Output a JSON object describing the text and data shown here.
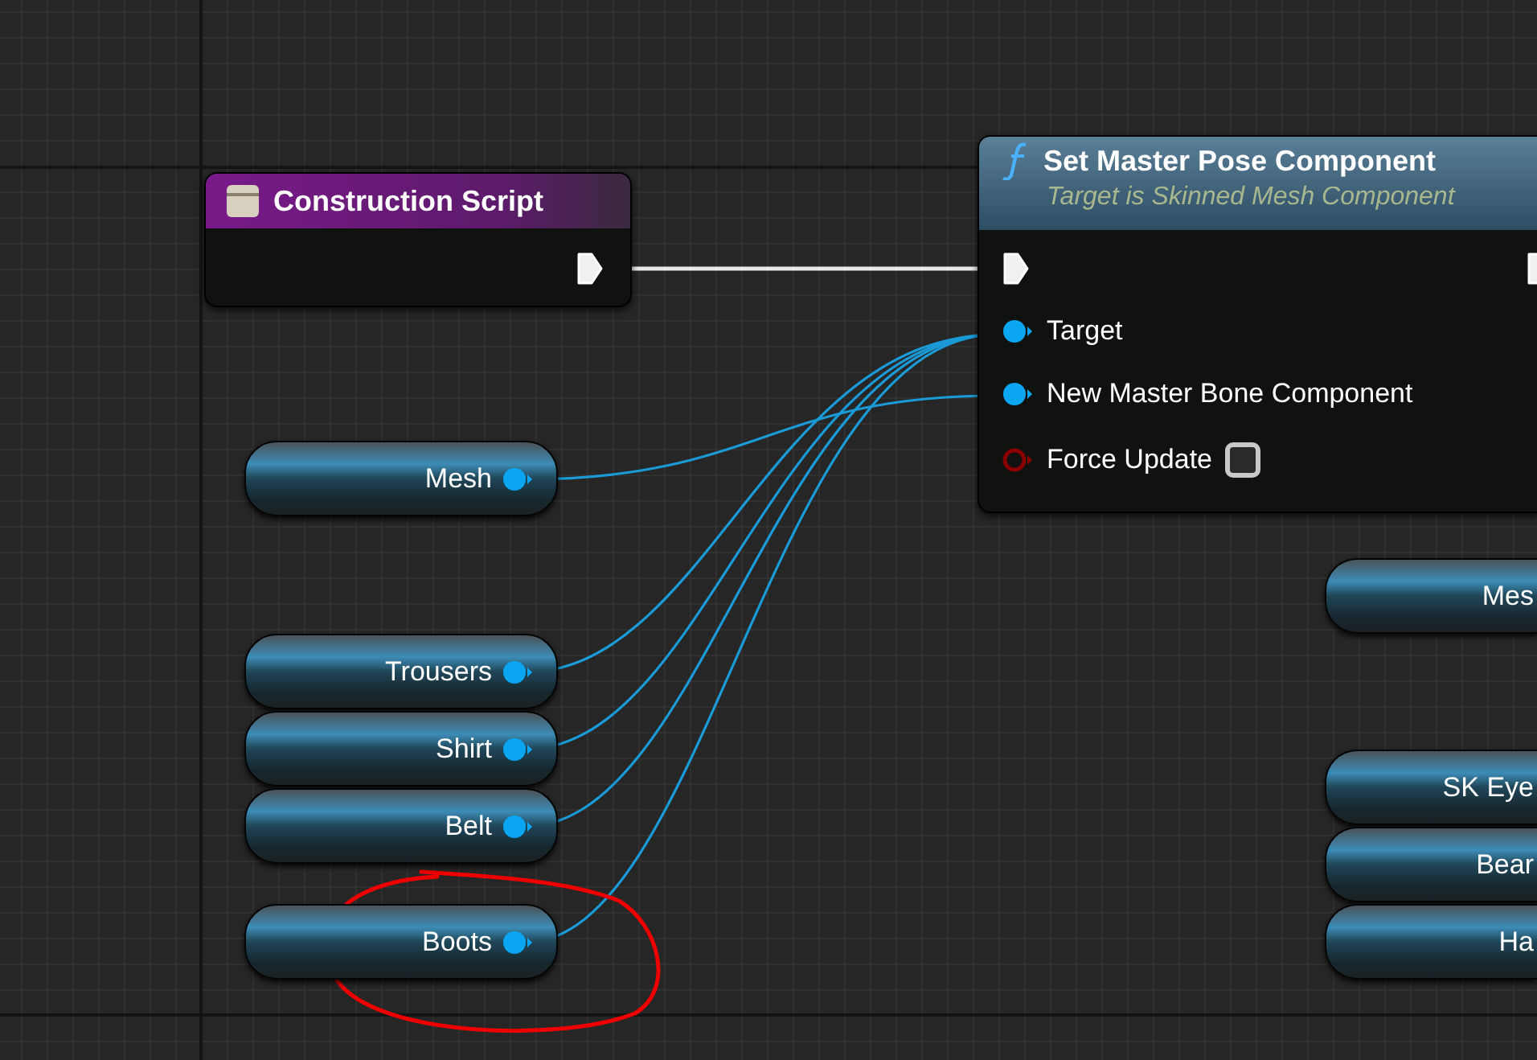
{
  "event_node": {
    "title": "Construction Script"
  },
  "function_node": {
    "title": "Set Master Pose Component",
    "subtitle": "Target is Skinned Mesh Component",
    "pins": [
      {
        "kind": "object",
        "label": "Target",
        "connected": true
      },
      {
        "kind": "object",
        "label": "New Master Bone Component",
        "connected": true
      },
      {
        "kind": "bool",
        "label": "Force Update",
        "connected": false,
        "checked": false
      }
    ]
  },
  "variables": [
    {
      "label": "Mesh",
      "connected": true
    },
    {
      "label": "Trousers",
      "connected": true
    },
    {
      "label": "Shirt",
      "connected": true
    },
    {
      "label": "Belt",
      "connected": true
    },
    {
      "label": "Boots",
      "connected": true
    }
  ],
  "cut_variables": [
    {
      "label": "Mes"
    },
    {
      "label": "SK Eye"
    },
    {
      "label": "Bear"
    },
    {
      "label": "Ha"
    }
  ]
}
